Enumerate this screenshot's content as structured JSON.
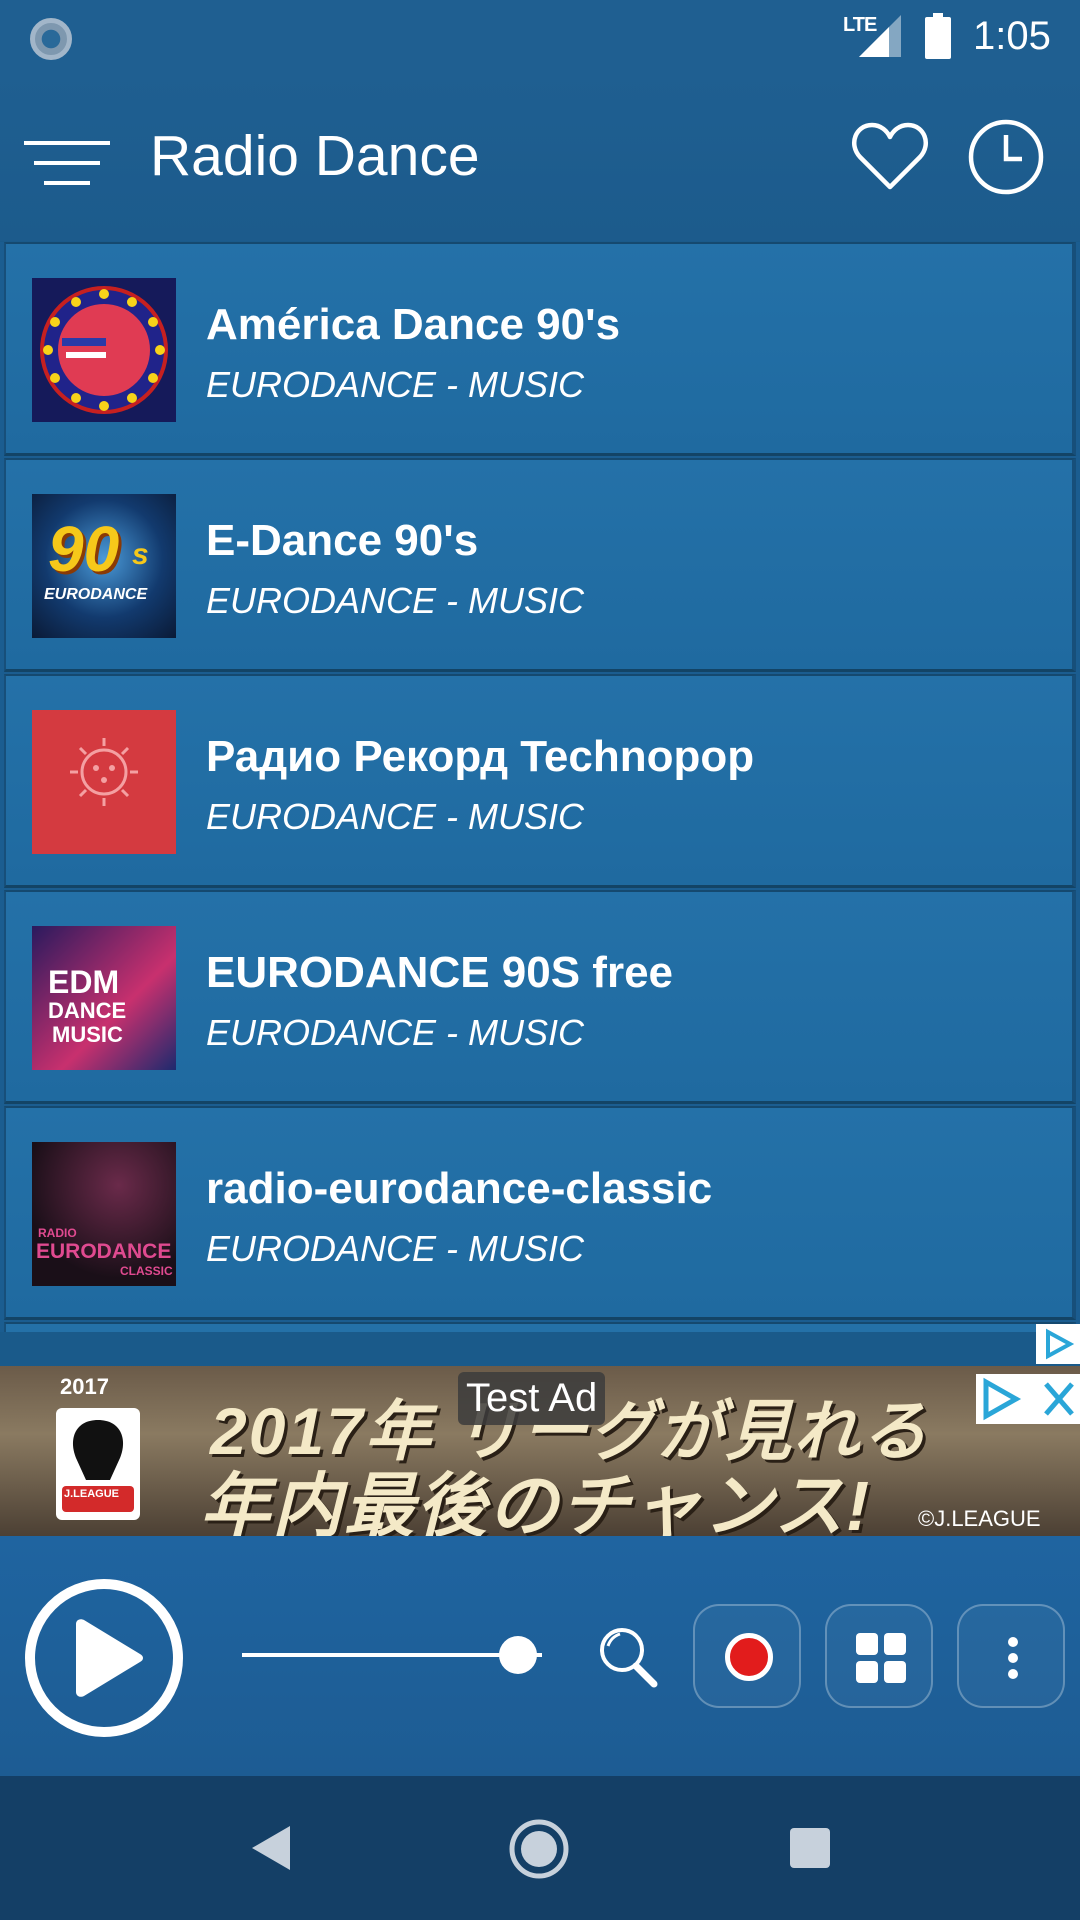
{
  "status_bar": {
    "network": "LTE",
    "time": "1:05"
  },
  "app_bar": {
    "title": "Radio Dance",
    "icons": [
      "menu-icon",
      "heart-icon",
      "history-icon"
    ]
  },
  "stations": [
    {
      "title": "América Dance 90's",
      "subtitle": "EURODANCE - MUSIC"
    },
    {
      "title": "E-Dance 90's",
      "subtitle": "EURODANCE - MUSIC"
    },
    {
      "title": "Радио Рекорд Technopop",
      "subtitle": "EURODANCE - MUSIC"
    },
    {
      "title": "EURODANCE 90S free",
      "subtitle": "EURODANCE - MUSIC"
    },
    {
      "title": "radio-eurodance-classic",
      "subtitle": "EURODANCE - MUSIC"
    }
  ],
  "thumb_text": {
    "e_dance_big": "90",
    "e_dance_small": "s",
    "e_dance_label": "EURODANCE",
    "edm_line1": "EDM",
    "edm_line2": "DANCE",
    "edm_line3": "MUSIC",
    "classic_line1": "RADIO",
    "classic_line2": "EURODANCE",
    "classic_line3": "CLASSIC"
  },
  "ad": {
    "label": "Test Ad",
    "year": "2017",
    "line1": "2017年 リーグが見れる",
    "line2": "年内最後のチャンス!",
    "logo_text": "J.LEAGUE",
    "copyright": "©J.LEAGUE"
  },
  "player": {
    "volume_fraction": 0.92,
    "controls": [
      "play-icon",
      "search-icon",
      "record-icon",
      "grid-icon",
      "more-vertical-icon"
    ]
  },
  "colors": {
    "background": "#1a5a8a",
    "row": "#2471a8",
    "record": "#e21c1c",
    "nav": "#143f66"
  }
}
